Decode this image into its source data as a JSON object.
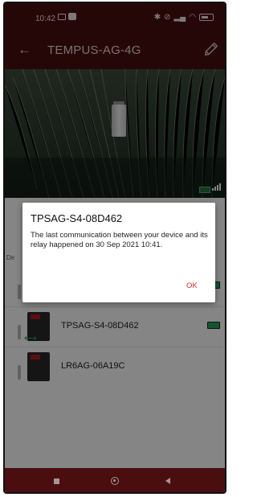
{
  "status_bar": {
    "time": "10:42",
    "icons": [
      "image-notification-icon",
      "notification-icon",
      "bluetooth-icon",
      "nfc-icon",
      "signal-icon",
      "wifi-icon",
      "battery-icon"
    ]
  },
  "app_bar": {
    "title": "TEMPUS-AG-4G",
    "back_icon": "arrow-left-icon",
    "edit_icon": "pencil-icon"
  },
  "hero": {
    "battery_icon": "battery-charging-icon",
    "signal_icon": "signal-bars-icon"
  },
  "list": {
    "section_hint": "De",
    "rows": [
      {
        "label": "",
        "battery": true
      },
      {
        "label": "TPSAG-S4-08D462",
        "battery": true,
        "link_icon": "link-arrows-icon"
      },
      {
        "label": "LR6AG-06A19C",
        "battery": false
      }
    ]
  },
  "dialog": {
    "title": "TPSAG-S4-08D462",
    "message": "The last communication between your device and its relay happened on 30 Sep 2021 10:41.",
    "ok_label": "OK"
  },
  "nav_bar": {
    "recents_icon": "square-icon",
    "home_icon": "circle-icon",
    "back_icon": "triangle-back-icon"
  },
  "colors": {
    "primary_dark": "#4a0e10",
    "accent_red": "#d32f2f",
    "battery_green": "#27a35a"
  }
}
